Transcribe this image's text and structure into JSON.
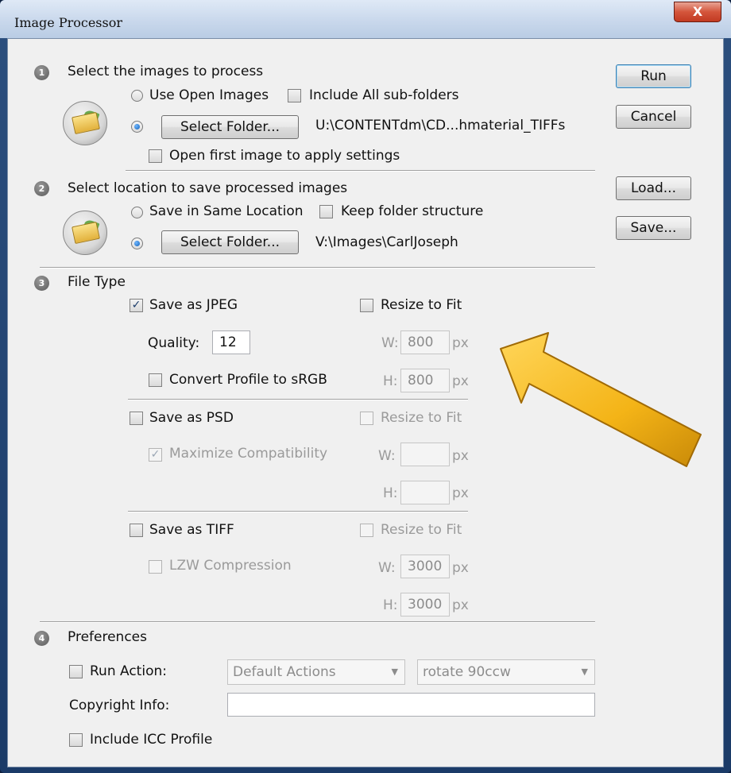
{
  "window": {
    "title": "Image Processor",
    "close_glyph": "X"
  },
  "sections": {
    "select_images": {
      "number": "1",
      "heading": "Select the images to process",
      "use_open_images": {
        "label": "Use Open Images",
        "selected": false
      },
      "include_subfolders": {
        "label": "Include All sub-folders",
        "checked": false
      },
      "select_folder_radio_selected": true,
      "select_folder_button": "Select Folder...",
      "source_path": "U:\\CONTENTdm\\CD...hmaterial_TIFFs",
      "open_first_image": {
        "label": "Open first image to apply settings",
        "checked": false
      }
    },
    "save_location": {
      "number": "2",
      "heading": "Select location to save processed images",
      "same_location": {
        "label": "Save in Same Location",
        "selected": false
      },
      "keep_structure": {
        "label": "Keep folder structure",
        "checked": false
      },
      "select_folder_radio_selected": true,
      "select_folder_button": "Select Folder...",
      "dest_path": "V:\\Images\\CarlJoseph"
    },
    "file_type": {
      "number": "3",
      "heading": "File Type",
      "jpeg": {
        "label": "Save as JPEG",
        "checked": true,
        "quality_label": "Quality:",
        "quality": "12",
        "convert_profile": {
          "label": "Convert Profile to sRGB",
          "checked": false
        },
        "resize": {
          "label": "Resize to Fit",
          "checked": false
        },
        "w_label": "W:",
        "w_value": "800",
        "h_label": "H:",
        "h_value": "800",
        "unit": "px"
      },
      "psd": {
        "label": "Save as PSD",
        "checked": false,
        "maximize": {
          "label": "Maximize Compatibility",
          "checked": true
        },
        "resize": {
          "label": "Resize to Fit",
          "checked": false
        },
        "w_label": "W:",
        "w_value": "",
        "h_label": "H:",
        "h_value": "",
        "unit": "px"
      },
      "tiff": {
        "label": "Save as TIFF",
        "checked": false,
        "lzw": {
          "label": "LZW Compression",
          "checked": false
        },
        "resize": {
          "label": "Resize to Fit",
          "checked": false
        },
        "w_label": "W:",
        "w_value": "3000",
        "h_label": "H:",
        "h_value": "3000",
        "unit": "px"
      }
    },
    "preferences": {
      "number": "4",
      "heading": "Preferences",
      "run_action": {
        "label": "Run Action:",
        "checked": false
      },
      "action_set": "Default Actions",
      "action": "rotate 90ccw",
      "copyright_label": "Copyright Info:",
      "copyright_value": "",
      "icc_profile": {
        "label": "Include ICC Profile",
        "checked": false
      }
    }
  },
  "buttons": {
    "run": "Run",
    "cancel": "Cancel",
    "load": "Load...",
    "save": "Save..."
  },
  "annotation": {
    "arrow_color": "#f4b417"
  },
  "icons": {
    "folder": "folder-icon",
    "check_glyph": "✓",
    "caret_glyph": "▼"
  }
}
